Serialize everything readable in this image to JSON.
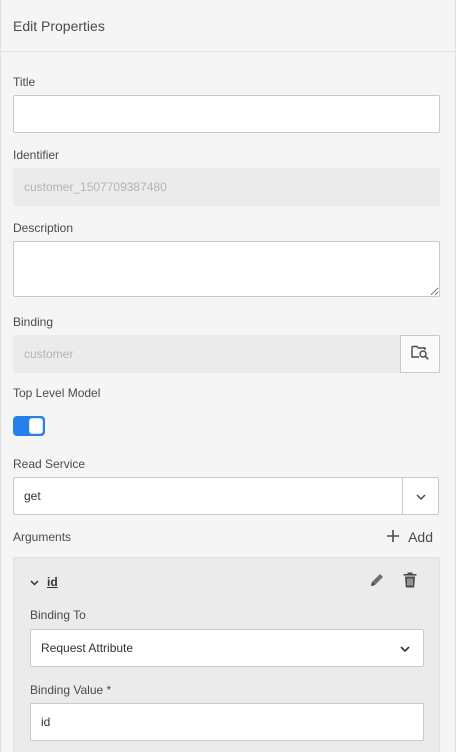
{
  "header": {
    "title": "Edit Properties"
  },
  "form": {
    "title_label": "Title",
    "title_value": "",
    "identifier_label": "Identifier",
    "identifier_value": "customer_1507709387480",
    "description_label": "Description",
    "description_value": "",
    "binding_label": "Binding",
    "binding_value": "customer",
    "top_level_label": "Top Level Model",
    "top_level_on": true,
    "read_service_label": "Read Service",
    "read_service_value": "get",
    "arguments_label": "Arguments",
    "add_label": "Add"
  },
  "argument": {
    "name": "id",
    "binding_to_label": "Binding To",
    "binding_to_value": "Request Attribute",
    "binding_value_label": "Binding Value *",
    "binding_value": "id"
  },
  "colors": {
    "accent": "#2680eb",
    "background": "#f5f5f5",
    "field_border": "#c9c9c9"
  }
}
